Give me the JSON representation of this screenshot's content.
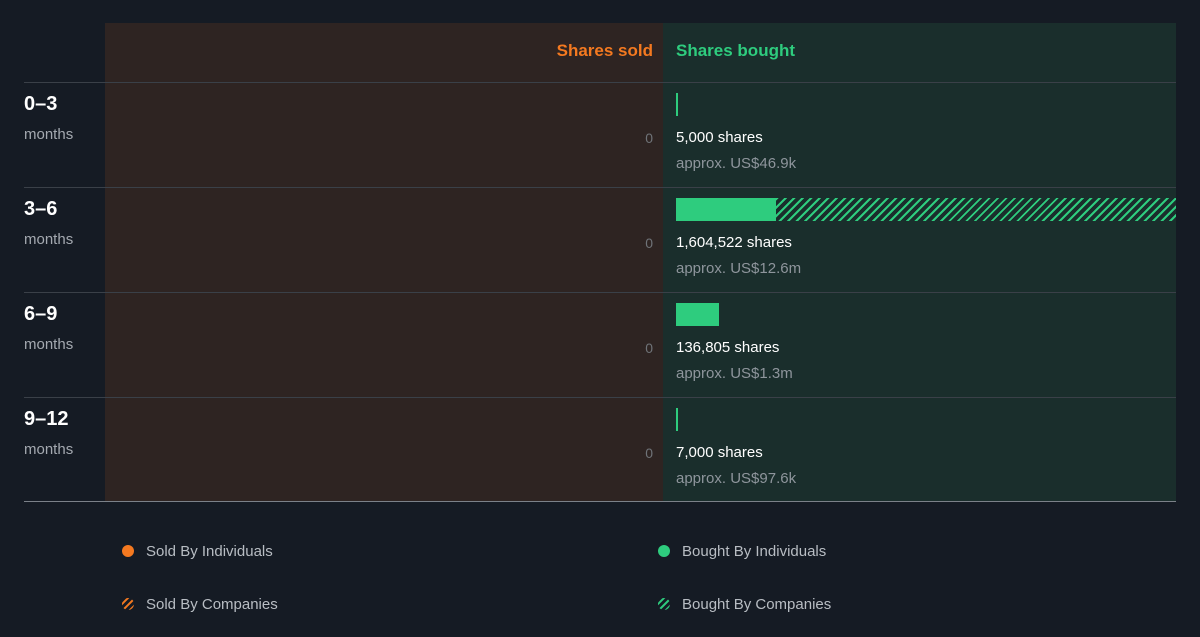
{
  "chart_data": {
    "type": "bar",
    "headers": {
      "sold": "Shares sold",
      "bought": "Shares bought"
    },
    "categories": [
      {
        "period": "0–3",
        "unit": "months"
      },
      {
        "period": "3–6",
        "unit": "months"
      },
      {
        "period": "6–9",
        "unit": "months"
      },
      {
        "period": "9–12",
        "unit": "months"
      }
    ],
    "max_value": 1604522,
    "series": [
      {
        "name": "Sold By Individuals",
        "values": [
          0,
          0,
          0,
          0
        ]
      },
      {
        "name": "Sold By Companies",
        "values": [
          0,
          0,
          0,
          0
        ]
      },
      {
        "name": "Bought By Individuals",
        "values": [
          5000,
          322000,
          136805,
          7000
        ]
      },
      {
        "name": "Bought By Companies",
        "values": [
          0,
          1282522,
          0,
          0
        ]
      }
    ],
    "sold_labels": [
      "0",
      "0",
      "0",
      "0"
    ],
    "bought_labels": [
      {
        "shares": "5,000 shares",
        "approx": "approx. US$46.9k"
      },
      {
        "shares": "1,604,522 shares",
        "approx": "approx. US$12.6m"
      },
      {
        "shares": "136,805 shares",
        "approx": "approx. US$1.3m"
      },
      {
        "shares": "7,000 shares",
        "approx": "approx. US$97.6k"
      }
    ],
    "legend": [
      {
        "label": "Sold By Individuals",
        "style": "solid",
        "color": "#f47920"
      },
      {
        "label": "Sold By Companies",
        "style": "hatched",
        "color": "#f47920"
      },
      {
        "label": "Bought By Individuals",
        "style": "solid",
        "color": "#2ecc7e"
      },
      {
        "label": "Bought By Companies",
        "style": "hatched",
        "color": "#2ecc7e"
      }
    ],
    "colors": {
      "sold": "#f47920",
      "bought": "#2ecc7e",
      "sold_bg": "#2e2422",
      "bought_bg": "#1a2e2c",
      "background": "#151b24"
    }
  }
}
